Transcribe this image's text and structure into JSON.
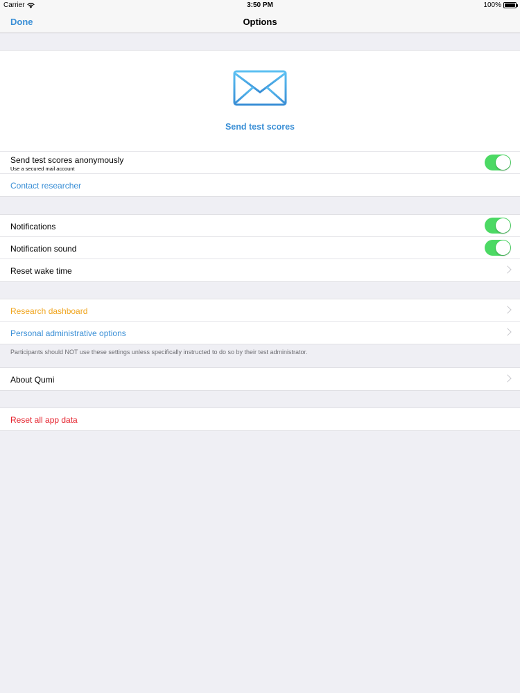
{
  "status_bar": {
    "carrier": "Carrier",
    "time": "3:50 PM",
    "battery": "100%"
  },
  "nav": {
    "done_label": "Done",
    "title": "Options"
  },
  "send_section": {
    "hero_label": "Send test scores",
    "anonymous_label": "Send test scores anonymously",
    "anonymous_sub": "Use a secured mail account",
    "anonymous_on": true,
    "contact_label": "Contact researcher"
  },
  "notification_section": {
    "notifications_label": "Notifications",
    "notifications_on": true,
    "sound_label": "Notification sound",
    "sound_on": true,
    "reset_wake_label": "Reset wake time"
  },
  "admin_section": {
    "dashboard_label": "Research dashboard",
    "personal_label": "Personal administrative options",
    "footnote": "Participants should NOT use these settings unless specifically instructed to do so by their test administrator."
  },
  "about_section": {
    "about_label": "About Qumi"
  },
  "reset_section": {
    "reset_label": "Reset all app data"
  },
  "colors": {
    "accent_blue": "#3a8fd6",
    "orange": "#f0a51e",
    "red": "#e5202b",
    "toggle_green": "#4cd964"
  }
}
